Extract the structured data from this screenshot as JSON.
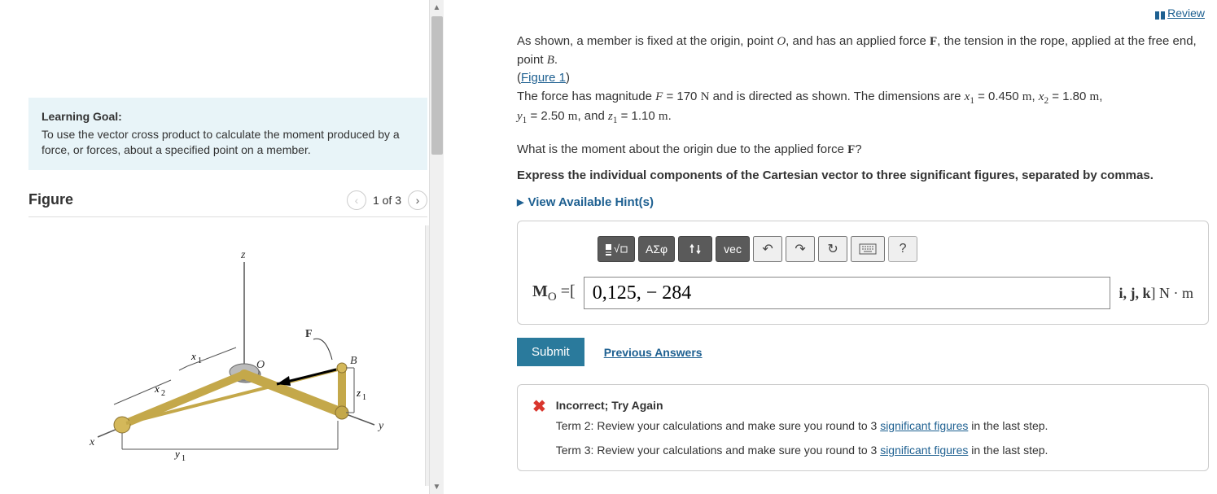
{
  "left": {
    "learning_goal_title": "Learning Goal:",
    "learning_goal_text": "To use the vector cross product to calculate the moment produced by a force, or forces, about a specified point on a member.",
    "figure_title": "Figure",
    "figure_counter": "1 of 3"
  },
  "right": {
    "review": " Review",
    "problem_intro_a": "As shown, a member is fixed at the origin, point ",
    "problem_point_o": "O",
    "problem_intro_b": ", and has an applied force ",
    "problem_force_f": "F",
    "problem_intro_c": ", the tension in the rope, applied at the free end, point ",
    "problem_point_b": "B",
    "problem_intro_d": ".",
    "figure_link": "Figure 1",
    "force_line_a": "The force has magnitude ",
    "force_var": "F",
    "force_val": " = 170 ",
    "unit_n": "N",
    "force_line_b": " and is directed as shown. The dimensions are ",
    "x1_var": "x",
    "x1_sub": "1",
    "x1_val": " = 0.450 ",
    "unit_m": "m",
    "x2_var": "x",
    "x2_sub": "2",
    "x2_val": " = 1.80 ",
    "y1_var": "y",
    "y1_sub": "1",
    "y1_val": " = 2.50 ",
    "z1_var": "z",
    "z1_sub": "1",
    "z1_val": " = 1.10 ",
    "and": ", and ",
    "comma": ", ",
    "question_a": "What is the moment about the origin due to the applied force ",
    "question_b": "?",
    "instruction": "Express the individual components of the Cartesian vector to three significant figures, separated by commas.",
    "hints_label": "View Available Hint(s)",
    "toolbar": {
      "greek": "ΑΣφ",
      "vec": "vec",
      "q": "?"
    },
    "answer": {
      "label_m": "M",
      "label_sub": "O",
      "label_eq": " =[ ",
      "value": "0,125, − 284",
      "unit_pre": "i, j, k",
      "unit_close": "] ",
      "unit_nm": "N · m"
    },
    "submit": "Submit",
    "prev_answers": "Previous Answers",
    "feedback": {
      "title": "Incorrect; Try Again",
      "term2_a": "Term 2: Review your calculations and make sure you round to 3 ",
      "sigfig": "significant figures",
      "term2_b": " in the last step.",
      "term3_a": "Term 3: Review your calculations and make sure you round to 3 ",
      "term3_b": " in the last step."
    }
  }
}
